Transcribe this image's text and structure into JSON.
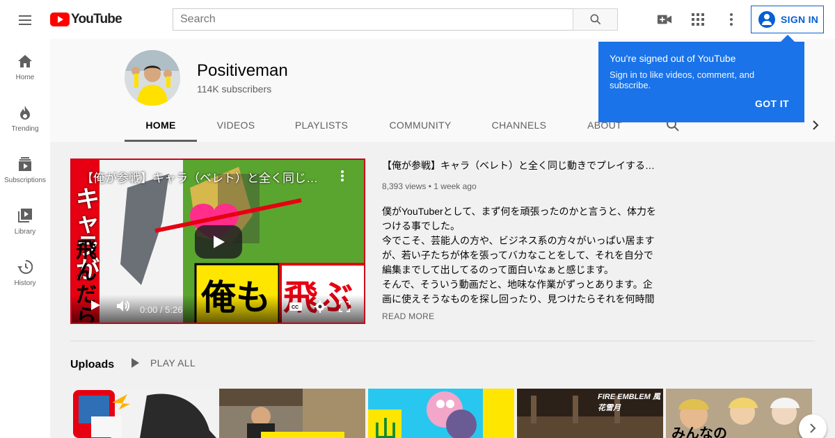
{
  "masthead": {
    "logo_text": "YouTube",
    "search_placeholder": "Search",
    "signin_label": "SIGN IN",
    "icons": [
      "menu-icon",
      "search-icon",
      "video-camera-icon",
      "apps-grid-icon",
      "more-vert-icon",
      "account-circle-icon"
    ]
  },
  "sidebar": {
    "items": [
      {
        "label": "Home",
        "icon": "home-icon"
      },
      {
        "label": "Trending",
        "icon": "flame-icon"
      },
      {
        "label": "Subscriptions",
        "icon": "subscriptions-icon"
      },
      {
        "label": "Library",
        "icon": "library-icon"
      },
      {
        "label": "History",
        "icon": "history-icon"
      }
    ]
  },
  "channel": {
    "name": "Positiveman",
    "subscribers": "114K subscribers"
  },
  "tabs": [
    {
      "label": "HOME",
      "active": true
    },
    {
      "label": "VIDEOS"
    },
    {
      "label": "PLAYLISTS"
    },
    {
      "label": "COMMUNITY"
    },
    {
      "label": "CHANNELS"
    },
    {
      "label": "ABOUT"
    }
  ],
  "popup": {
    "title": "You're signed out of YouTube",
    "body": "Sign in to like videos, comment, and subscribe.",
    "button": "GOT IT"
  },
  "featured": {
    "overlay_title": "【俺が参戦】キャラ（ベレト）と全く同じ…",
    "title": "【俺が参戦】キャラ（ベレト）と全く同じ動きでプレイする…",
    "views": "8,393 views",
    "age": "1 week ago",
    "time": "0:00 / 5:26",
    "description": [
      "僕がYouTuberとして、まず何を頑張ったのかと言うと、体力を",
      "つける事でした。",
      "今でこそ、芸能人の方や、ビジネス系の方々がいっぱい居ます",
      "が、若い子たちが体を張ってバカなことをして、それを自分で",
      "編集までして出してるのって面白いなぁと感じます。",
      "そんで、そういう動画だと、地味な作業がずっとあります。企",
      "画に使えそうなものを探し回ったり、見つけたらそれを何時間"
    ],
    "read_more": "READ MORE",
    "thumb_text": [
      "キャラが",
      "飛んだら",
      "俺も",
      "飛ぶ"
    ]
  },
  "uploads": {
    "title": "Uploads",
    "play_all": "PLAY ALL",
    "thumb_texts": [
      "",
      "",
      "山",
      "FIRE EMBLEM 風花雪月",
      "みんなの"
    ]
  },
  "colors": {
    "brand_red": "#ff0000",
    "accent_blue": "#065fd4",
    "popup_blue": "#1a73e8"
  }
}
